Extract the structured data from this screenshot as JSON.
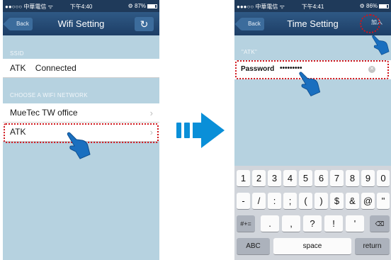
{
  "colors": {
    "nav": "#1d3e66",
    "background": "#b6d2e0",
    "highlight": "#d0151b",
    "arrow": "#0a8fd8"
  },
  "left_phone": {
    "status": {
      "carrier": "●●○○○ 中華電信 ᯤ",
      "time": "下午4:40",
      "battery": "⚙ 87%"
    },
    "nav": {
      "back": "Back",
      "title": "Wifi Setting",
      "right_icon": "refresh-icon"
    },
    "ssid_header": "SSID",
    "current": {
      "name": "ATK",
      "status": "Connected"
    },
    "choose_header": "CHOOSE A WIFI NETWORK",
    "networks": [
      {
        "name": "MueTec  TW office",
        "chevron": "›"
      },
      {
        "name": "ATK",
        "chevron": "›"
      }
    ]
  },
  "right_phone": {
    "status": {
      "carrier": "●●●○○ 中華電信 ᯤ",
      "time": "下午4:41",
      "battery": "⚙ 86%"
    },
    "nav": {
      "back": "Back",
      "title": "Time Setting",
      "join": "加入"
    },
    "network_label": "\"ATK\"",
    "password_label": "Password",
    "password_value": "•••••••••",
    "keyboard": {
      "row1": [
        "1",
        "2",
        "3",
        "4",
        "5",
        "6",
        "7",
        "8",
        "9",
        "0"
      ],
      "row2": [
        "-",
        "/",
        ":",
        ";",
        "(",
        ")",
        "$",
        "&",
        "@",
        "\""
      ],
      "row3": [
        "#+=",
        ".",
        ",",
        "?",
        "!",
        "'",
        "⌫"
      ],
      "row4": [
        "ABC",
        "space",
        "return"
      ]
    }
  }
}
